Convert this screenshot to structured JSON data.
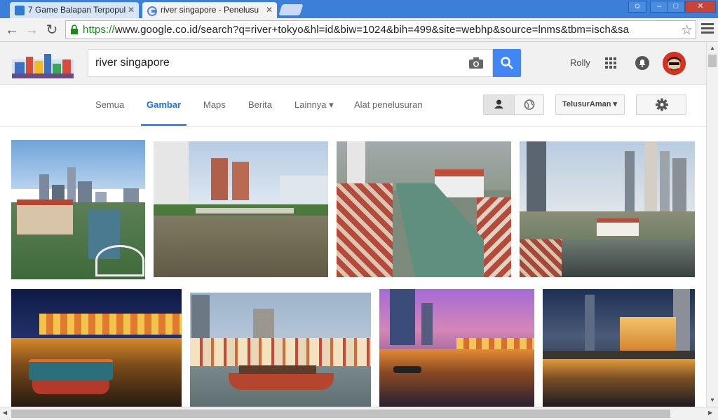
{
  "browser": {
    "tabs": [
      {
        "title": "7 Game Balapan Terpopul",
        "close": "✕"
      },
      {
        "title": "river singapore - Penelusu",
        "close": "✕"
      }
    ],
    "url_protocol": "https://",
    "url_rest": "www.google.co.id/search?q=river+tokyo&hl=id&biw=1024&bih=499&site=webhp&source=lnms&tbm=isch&sa"
  },
  "google": {
    "search_query": "river singapore",
    "user_name": "Rolly",
    "accent": "#4285f4"
  },
  "nav_tabs": [
    {
      "label": "Semua"
    },
    {
      "label": "Gambar"
    },
    {
      "label": "Maps"
    },
    {
      "label": "Berita"
    },
    {
      "label": "Lainnya ▾"
    },
    {
      "label": "Alat penelusuran"
    }
  ],
  "safe_search_label": "TelusurAman ▾",
  "images": [
    {
      "name": "singapore-river-aerial-marina-bay"
    },
    {
      "name": "singapore-river-bridge-daytime"
    },
    {
      "name": "singapore-river-aerial-bend"
    },
    {
      "name": "singapore-river-skyline-panorama"
    },
    {
      "name": "clarke-quay-night-boat"
    },
    {
      "name": "boat-quay-shophouses-bumboat"
    },
    {
      "name": "clarke-quay-dusk-reflections"
    },
    {
      "name": "fullerton-hotel-night-river"
    }
  ]
}
